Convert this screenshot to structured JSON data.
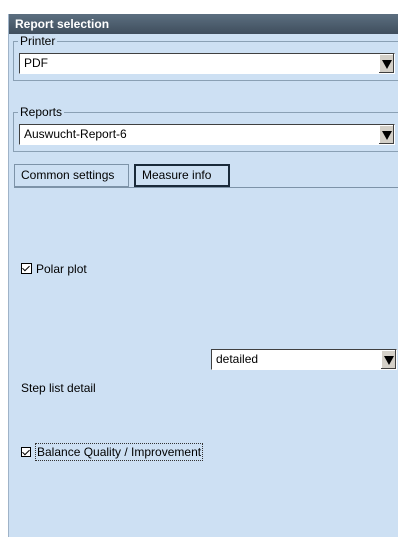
{
  "title": "Report selection",
  "printer": {
    "legend": "Printer",
    "selected": "PDF"
  },
  "reports": {
    "legend": "Reports",
    "selected": "Auswucht-Report-6"
  },
  "tabs": [
    {
      "label": "Common settings",
      "active": false
    },
    {
      "label": "Measure info",
      "active": true
    }
  ],
  "content": {
    "polar_plot": {
      "label": "Polar plot",
      "checked": true
    },
    "step_list": {
      "label": "Step list detail",
      "selected": "detailed"
    },
    "balance_quality": {
      "label": "Balance Quality / Improvement",
      "checked": true
    }
  },
  "colors": {
    "panel_bg": "#cde0f3",
    "titlebar": "#4a5a6a"
  }
}
